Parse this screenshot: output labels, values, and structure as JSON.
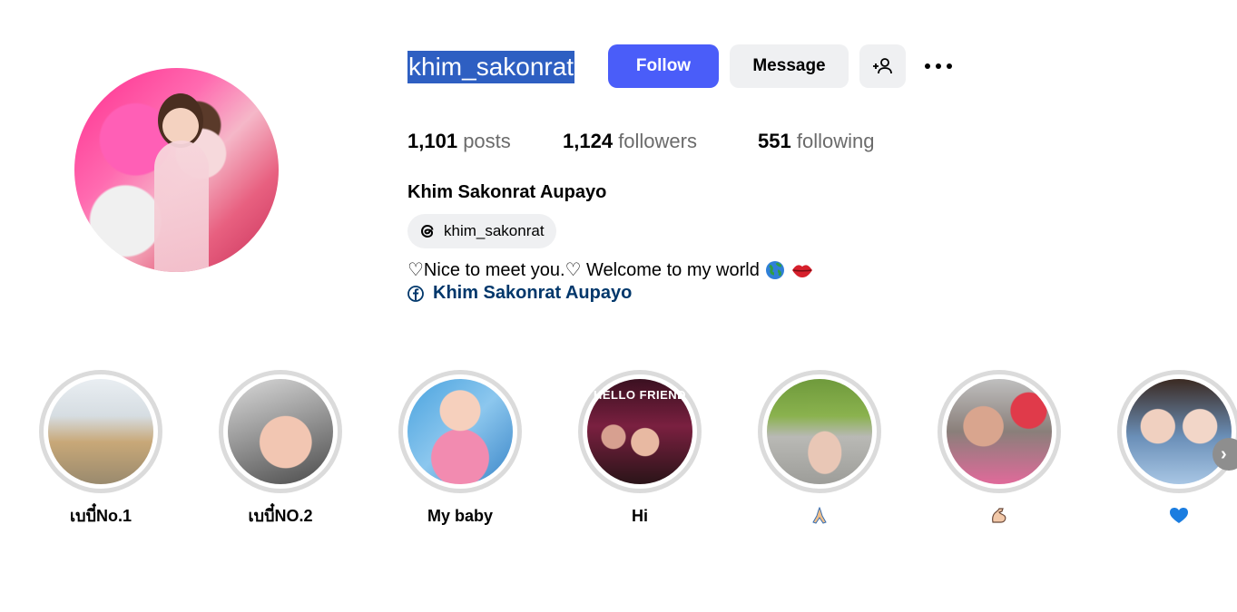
{
  "profile": {
    "username": "khim_sakonrat",
    "full_name": "Khim Sakonrat Aupayo",
    "follow_label": "Follow",
    "message_label": "Message",
    "stats": {
      "posts_count": "1,101",
      "posts_label": "posts",
      "followers_count": "1,124",
      "followers_label": "followers",
      "following_count": "551",
      "following_label": "following"
    },
    "threads_handle": "khim_sakonrat",
    "bio": "♡Nice to meet you.♡ Welcome to my world",
    "bio_emojis": [
      "globe-icon",
      "lips-icon"
    ],
    "facebook_link": "Khim Sakonrat Aupayo"
  },
  "highlights": [
    {
      "label": "เบบี๋No.1"
    },
    {
      "label": "เบบี๋NO.2"
    },
    {
      "label": "My baby"
    },
    {
      "label": "Hi"
    },
    {
      "label": "🙏",
      "icon": "pray-emoji-icon"
    },
    {
      "label": "💪",
      "icon": "flexed-biceps-emoji-icon"
    },
    {
      "label": "💙",
      "icon": "blue-heart-emoji-icon"
    }
  ],
  "highlight_overlay_text": {
    "hi": "HELLO FRIEND"
  },
  "colors": {
    "accent": "#4a5df9",
    "link": "#00376b",
    "selection": "#2e5fc2",
    "button_bg": "#eff0f2"
  }
}
